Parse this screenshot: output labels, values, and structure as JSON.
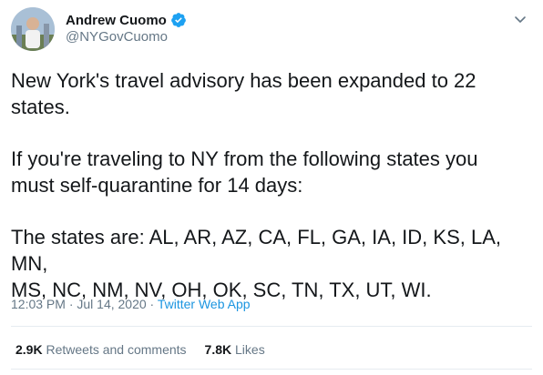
{
  "author": {
    "display_name": "Andrew Cuomo",
    "handle": "@NYGovCuomo",
    "verified_color": "#1da1f2"
  },
  "tweet": {
    "line1": "New York's travel advisory has been expanded to 22",
    "line2": "states.",
    "line3": "If you're traveling to NY from the following states you",
    "line4": "must self-quarantine for 14 days:",
    "line5": "The states are: AL, AR, AZ, CA, FL, GA, IA, ID, KS, LA, MN,",
    "line6": "MS, NC, NM, NV, OH, OK, SC, TN, TX, UT, WI."
  },
  "meta": {
    "time_date": "12:03 PM · Jul 14, 2020 · ",
    "app": "Twitter Web App"
  },
  "stats": {
    "retweets_count": "2.9K",
    "retweets_label": "Retweets and comments",
    "likes_count": "7.8K",
    "likes_label": "Likes"
  },
  "icons": {
    "verified": "verified-badge-icon",
    "menu": "chevron-down-icon"
  },
  "colors": {
    "link": "#1b95e0",
    "secondary_text": "#657786",
    "divider": "#e6ecf0"
  }
}
